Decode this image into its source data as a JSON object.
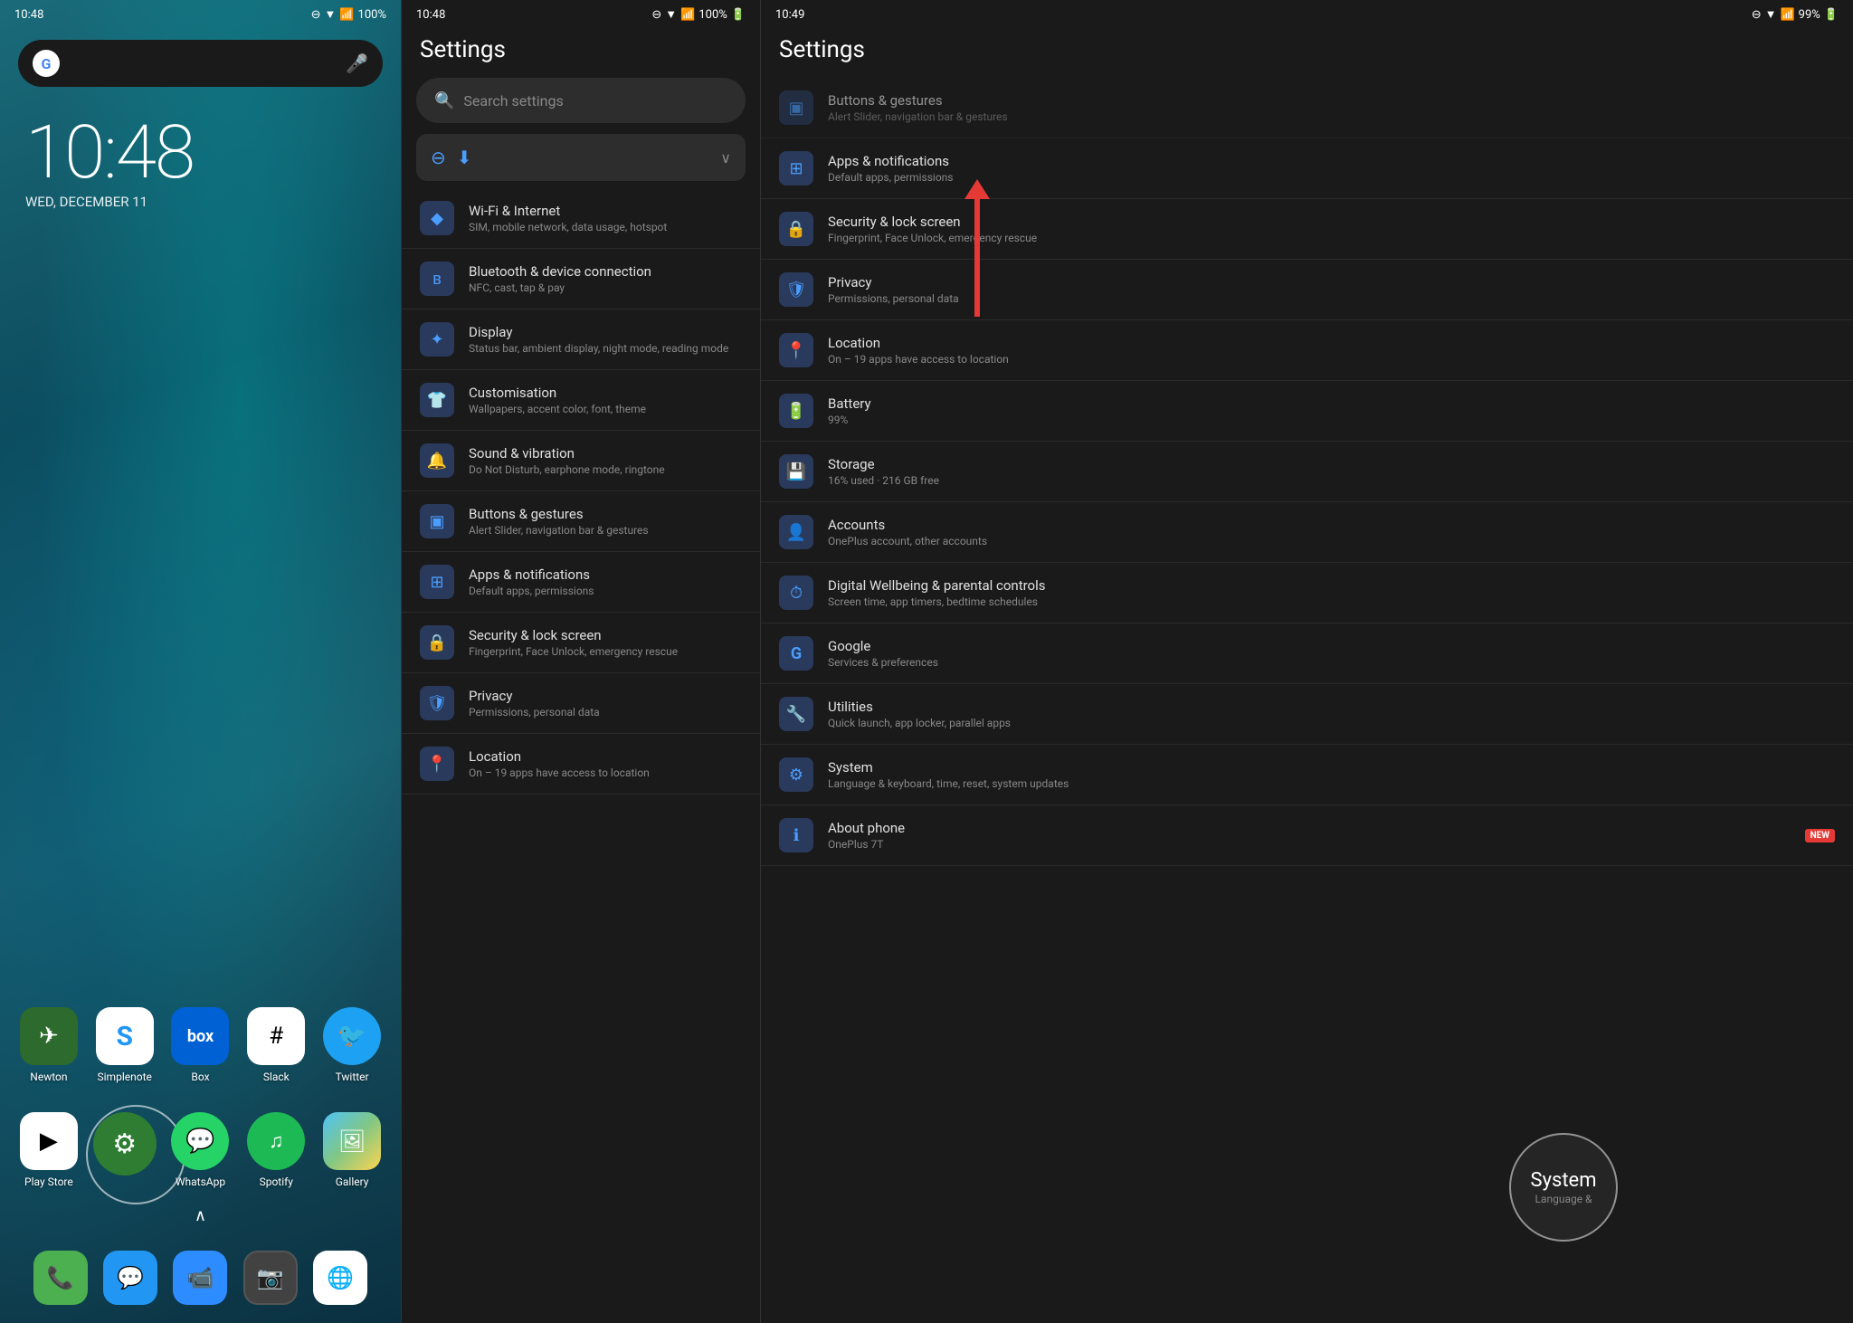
{
  "home": {
    "status_time": "10:48",
    "battery": "100%",
    "clock_time": "10:48",
    "clock_date": "WED, DECEMBER 11",
    "apps_row1": [
      {
        "name": "Newton",
        "label": "Newton"
      },
      {
        "name": "Simplenote",
        "label": "Simplenote"
      },
      {
        "name": "Box",
        "label": "Box"
      },
      {
        "name": "Slack",
        "label": "Slack"
      },
      {
        "name": "Twitter",
        "label": "Twitter"
      }
    ],
    "apps_row2": [
      {
        "name": "Play Store",
        "label": "Play Store"
      },
      {
        "name": "Settings",
        "label": ""
      },
      {
        "name": "WhatsApp",
        "label": "WhatsApp"
      },
      {
        "name": "Spotify",
        "label": "Spotify"
      },
      {
        "name": "Gallery",
        "label": "Gallery"
      }
    ],
    "dock": [
      {
        "name": "Phone",
        "label": ""
      },
      {
        "name": "Messages",
        "label": ""
      },
      {
        "name": "Zoom",
        "label": ""
      },
      {
        "name": "Camera",
        "label": ""
      },
      {
        "name": "Chrome",
        "label": ""
      }
    ]
  },
  "settings1": {
    "status_time": "10:48",
    "battery": "100%",
    "title": "Settings",
    "search_placeholder": "Search settings",
    "items": [
      {
        "title": "Wi-Fi & Internet",
        "sub": "SIM, mobile network, data usage, hotspot"
      },
      {
        "title": "Bluetooth & device connection",
        "sub": "NFC, cast, tap & pay"
      },
      {
        "title": "Display",
        "sub": "Status bar, ambient display, night mode, reading mode"
      },
      {
        "title": "Customisation",
        "sub": "Wallpapers, accent color, font, theme"
      },
      {
        "title": "Sound & vibration",
        "sub": "Do Not Disturb, earphone mode, ringtone"
      },
      {
        "title": "Buttons & gestures",
        "sub": "Alert Slider, navigation bar & gestures"
      },
      {
        "title": "Apps & notifications",
        "sub": "Default apps, permissions"
      },
      {
        "title": "Security & lock screen",
        "sub": "Fingerprint, Face Unlock, emergency rescue"
      },
      {
        "title": "Privacy",
        "sub": "Permissions, personal data"
      },
      {
        "title": "Location",
        "sub": "On – 19 apps have access to location"
      }
    ]
  },
  "settings2": {
    "status_time": "10:49",
    "battery": "99%",
    "title": "Settings",
    "items": [
      {
        "title": "Buttons & gestures",
        "sub": "Alert Slider, navigation bar & gestures"
      },
      {
        "title": "Apps & notifications",
        "sub": "Default apps, permissions"
      },
      {
        "title": "Security & lock screen",
        "sub": "Fingerprint, Face Unlock, emergency rescue"
      },
      {
        "title": "Privacy",
        "sub": "Permissions, personal data"
      },
      {
        "title": "Location",
        "sub": "On – 19 apps have access to location"
      },
      {
        "title": "Battery",
        "sub": "99%"
      },
      {
        "title": "Storage",
        "sub": "16% used · 216 GB free"
      },
      {
        "title": "Accounts",
        "sub": "OnePlus account, other accounts"
      },
      {
        "title": "Digital Wellbeing & parental controls",
        "sub": "Screen time, app timers, bedtime schedules"
      },
      {
        "title": "Google",
        "sub": "Services & preferences"
      },
      {
        "title": "Utilities",
        "sub": "Quick launch, app locker, parallel apps"
      },
      {
        "title": "System",
        "sub": "Language & keyboard, time, reset, system updates"
      },
      {
        "title": "About phone",
        "sub": "OnePlus 7T"
      }
    ],
    "new_badge": "NEW",
    "system_circle_title": "System",
    "system_circle_sub": "Language &"
  }
}
